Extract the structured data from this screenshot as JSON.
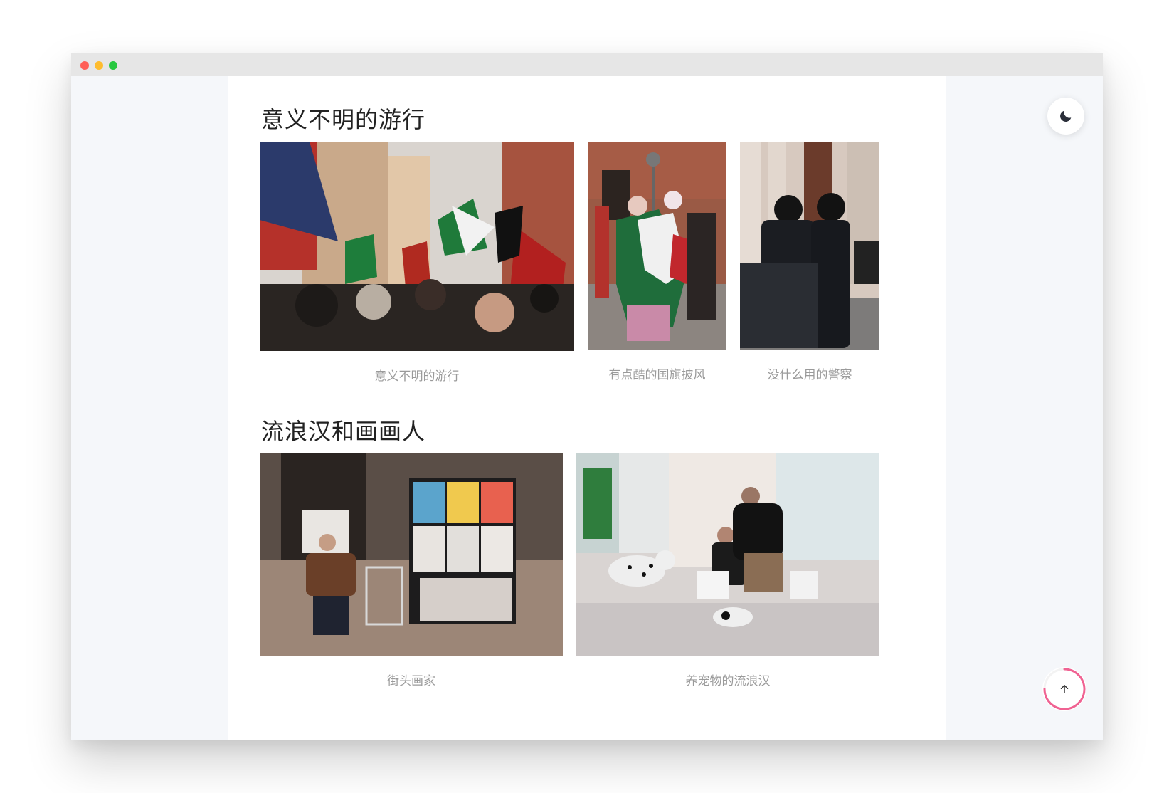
{
  "sections": [
    {
      "title": "意义不明的游行",
      "photos": [
        {
          "caption": "意义不明的游行"
        },
        {
          "caption": "有点酷的国旗披风"
        },
        {
          "caption": "没什么用的警察"
        }
      ]
    },
    {
      "title": "流浪汉和画画人",
      "photos": [
        {
          "caption": "街头画家"
        },
        {
          "caption": "养宠物的流浪汉"
        }
      ]
    }
  ],
  "controls": {
    "theme_icon": "moon-icon",
    "back_to_top_icon": "arrow-up-icon",
    "scroll_progress": 0.75
  },
  "colors": {
    "progress_ring": "#f06292",
    "page_bg": "#f5f7fa"
  }
}
